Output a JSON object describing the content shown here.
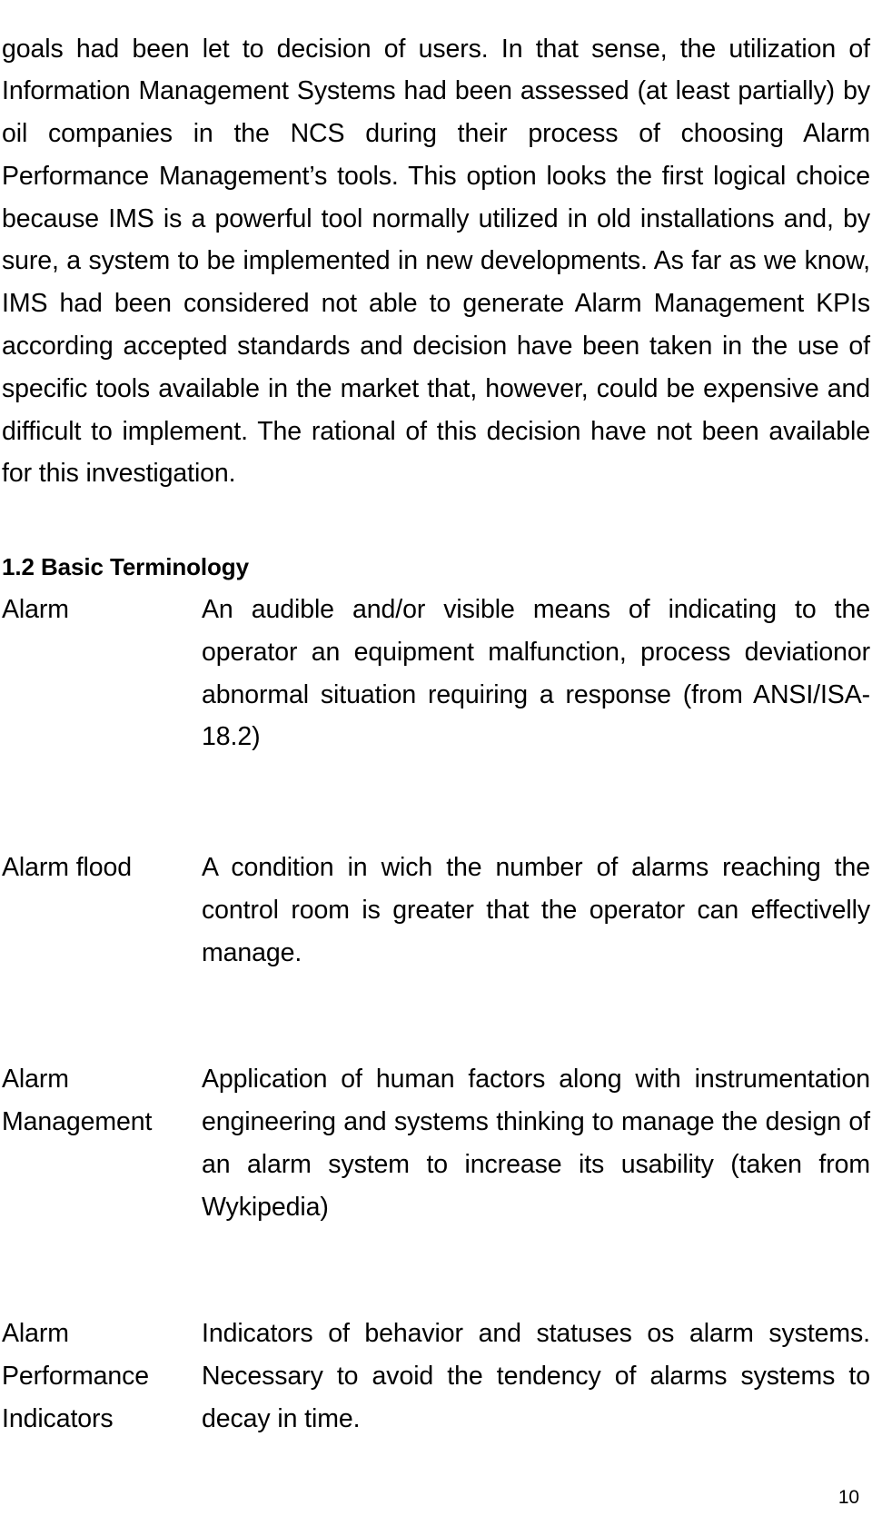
{
  "document": {
    "page_number": "10",
    "body_paragraph": "goals had been let to decision of users. In that sense, the utilization of Information Management Systems had been assessed (at least partially) by oil companies in the NCS during their process of choosing Alarm Performance Management’s tools. This option looks the first logical choice because IMS is a powerful tool normally utilized in old installations and, by sure, a system to be implemented in new developments. As far as we know, IMS had been considered not able to generate Alarm Management KPIs according accepted standards and decision have been taken in the use of specific tools available in the market that, however, could be expensive and difficult to implement. The rational of this decision have not been available for this investigation.",
    "section": {
      "number": "1.2",
      "title": "Basic Terminology",
      "heading": "1.2 Basic Terminology"
    },
    "glossary": [
      {
        "term": "Alarm",
        "definition": "An audible and/or visible means of indicating to the operator an equipment malfunction, process deviationor abnormal situation requiring a response (from ANSI/ISA-18.2)"
      },
      {
        "term": "Alarm flood",
        "definition": "A condition in wich the number of alarms reaching the control room is greater that the operator can effectivelly manage."
      },
      {
        "term": "Alarm\nManagement",
        "definition": "Application of human factors along with instrumentation engineering and systems thinking to manage the design of an alarm system to increase its usability  (taken from Wykipedia)"
      },
      {
        "term": "Alarm\nPerformance\nIndicators",
        "definition": "Indicators of behavior and statuses os alarm systems. Necessary to avoid the tendency of alarms systems to decay in time."
      }
    ]
  }
}
